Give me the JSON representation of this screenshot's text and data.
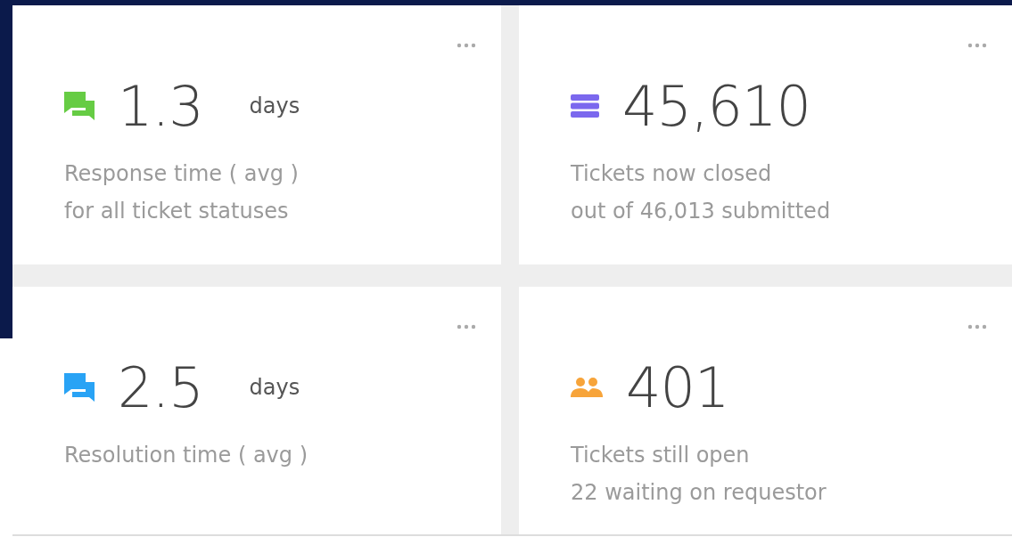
{
  "cards": [
    {
      "kind": "chat",
      "color": "#66cc44",
      "value": "1.3",
      "unit": "days",
      "lines": [
        "Response time ( avg )",
        "for all ticket statuses"
      ]
    },
    {
      "kind": "list",
      "color": "#7b68ee",
      "value": "45,610",
      "lines": [
        "Tickets now closed",
        "out of 46,013 submitted"
      ]
    },
    {
      "kind": "chat",
      "color": "#29a3f5",
      "value": "2.5",
      "unit": "days",
      "lines": [
        "Resolution time ( avg )"
      ]
    },
    {
      "kind": "people",
      "color": "#f7a43a",
      "value": "401",
      "lines": [
        "Tickets still open",
        "22 waiting on requestor"
      ]
    }
  ]
}
